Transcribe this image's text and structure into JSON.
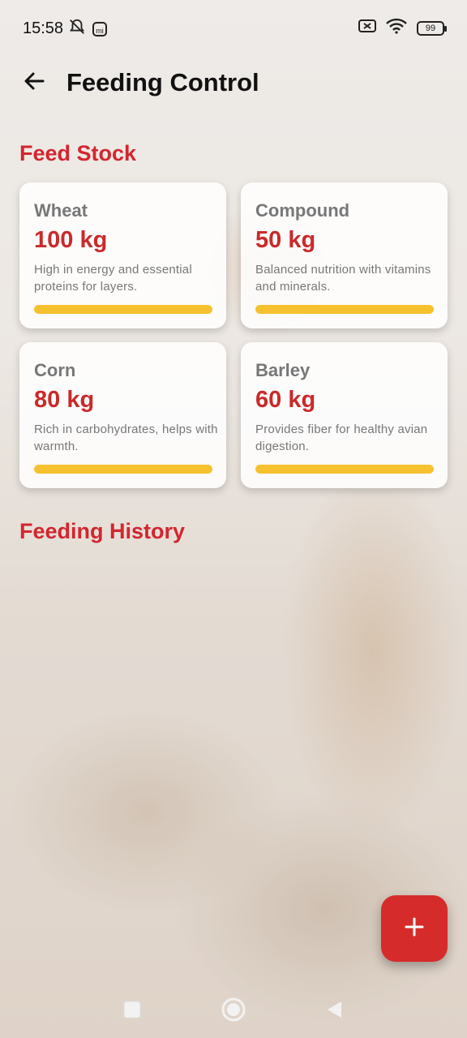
{
  "status_bar": {
    "time": "15:58",
    "mi_label": "mi",
    "battery": "99",
    "icons": [
      "mute-notifications-icon",
      "mi-icon",
      "sim-off-icon",
      "wifi-icon",
      "battery-icon"
    ]
  },
  "app_bar": {
    "title": "Feeding Control",
    "back_icon": "arrow-left-icon"
  },
  "feed_stock": {
    "title": "Feed Stock",
    "items": [
      {
        "name": "Wheat",
        "amount": "100 kg",
        "description": "High in energy and essential proteins for layers.",
        "level": 1.0
      },
      {
        "name": "Compound",
        "amount": "50 kg",
        "description": "Balanced nutrition with vitamins and minerals.",
        "level": 1.0
      },
      {
        "name": "Corn",
        "amount": "80 kg",
        "description": "Rich in carbohydrates, helps with warmth.",
        "level": 1.0
      },
      {
        "name": "Barley",
        "amount": "60 kg",
        "description": "Provides fiber for healthy avian digestion.",
        "level": 1.0
      }
    ]
  },
  "feeding_history": {
    "title": "Feeding History"
  },
  "fab": {
    "icon": "plus-icon"
  },
  "colors": {
    "accent_red": "#d3262f",
    "fab_red": "#d62b2b",
    "bar_yellow": "#f6c12e"
  },
  "nav_bar": {
    "icons": [
      "recents-square-icon",
      "home-circle-icon",
      "back-triangle-icon"
    ]
  }
}
